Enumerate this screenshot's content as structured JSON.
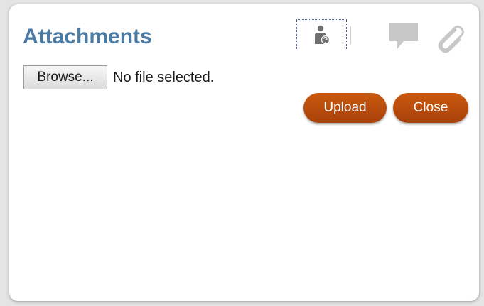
{
  "dialog": {
    "title": "Attachments"
  },
  "toolbar": {
    "icons": [
      "user-help-icon",
      "comment-icon",
      "paperclip-icon"
    ],
    "icon_color": "#c8c8c8"
  },
  "file_input": {
    "browse_label": "Browse...",
    "status_text": "No file selected."
  },
  "actions": {
    "upload_label": "Upload",
    "close_label": "Close",
    "accent_color": "#b84c0b"
  },
  "colors": {
    "title": "#4b7aa3",
    "background": "#ffffff"
  }
}
